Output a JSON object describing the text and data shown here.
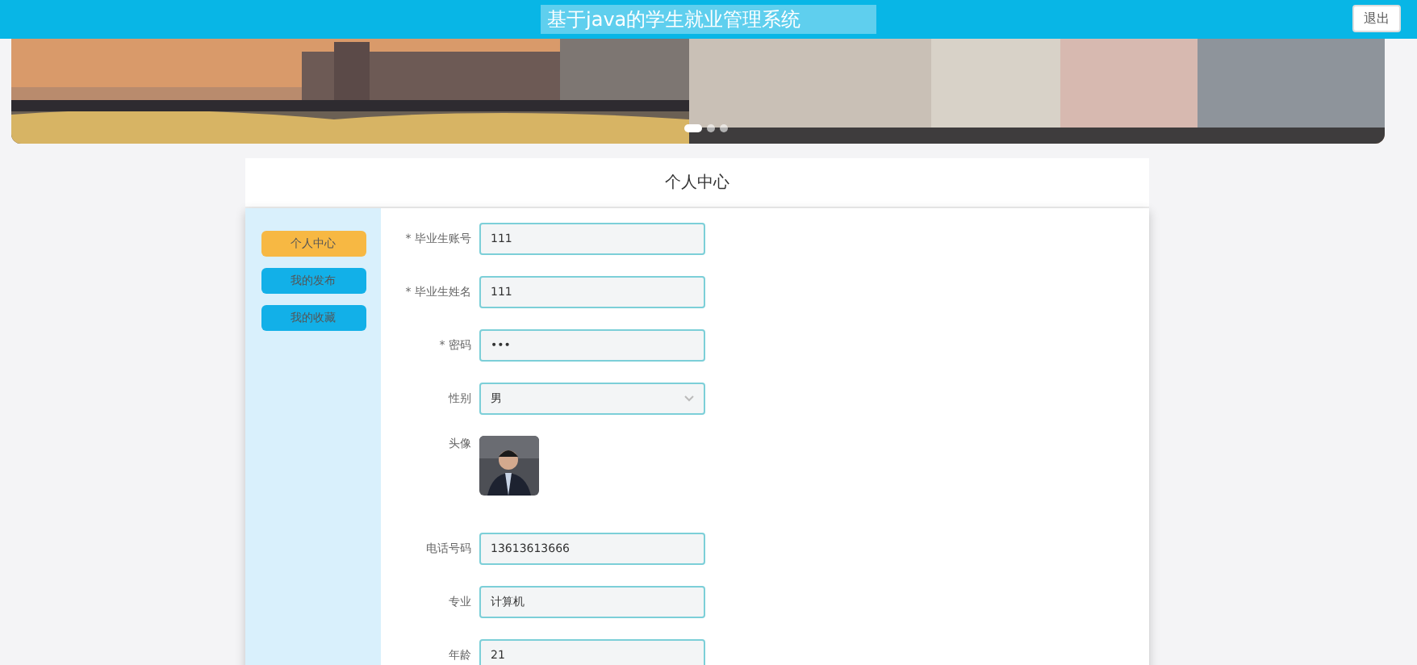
{
  "header": {
    "title": "基于java的学生就业管理系统",
    "logout": "退出"
  },
  "banner": {
    "kind": "picture",
    "dots": [
      {
        "selected": true
      },
      {
        "selected": false
      },
      {
        "selected": false
      }
    ]
  },
  "page_title": "个人中心",
  "sidebar": {
    "items": [
      {
        "label": "个人中心",
        "selected": true
      },
      {
        "label": "我的发布",
        "selected": false
      },
      {
        "label": "我的收藏",
        "selected": false
      }
    ]
  },
  "form": {
    "fields": [
      {
        "kind": "text",
        "label": "* 毕业生账号",
        "value": "111"
      },
      {
        "kind": "text",
        "label": "* 毕业生姓名",
        "value": "111"
      },
      {
        "kind": "text",
        "label": "* 密码",
        "value": "•••"
      },
      {
        "kind": "select",
        "label": "性别",
        "value": "男"
      },
      {
        "label": "头像"
      },
      {
        "kind": "text",
        "label": "电话号码",
        "value": "13613613666"
      },
      {
        "kind": "text",
        "label": "专业",
        "value": "计算机"
      },
      {
        "kind": "text",
        "label": "年龄",
        "value": "21"
      }
    ]
  }
}
